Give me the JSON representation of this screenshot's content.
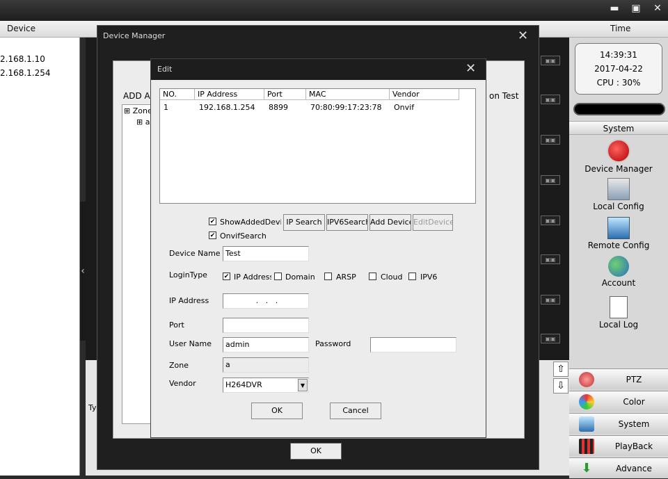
{
  "header": {
    "device_label": "Device",
    "time_label": "Time"
  },
  "left_list": {
    "items": [
      "2.168.1.10",
      "2.168.1.254"
    ]
  },
  "video_cell_icon": "camera-icon",
  "dm_partial": {
    "add": "ADD AR",
    "zone": "Zone",
    "zone_child": "a",
    "test": "on Test",
    "bottom_tab": "Ty"
  },
  "clock": {
    "time": "14:39:31",
    "date": "2017-04-22",
    "cpu": "CPU : 30%"
  },
  "system_header": "System",
  "tools": [
    {
      "label": "Device Manager",
      "icon": "device-manager-icon"
    },
    {
      "label": "Local Config",
      "icon": "local-config-icon"
    },
    {
      "label": "Remote Config",
      "icon": "remote-config-icon"
    },
    {
      "label": "Account",
      "icon": "account-icon"
    },
    {
      "label": "Local Log",
      "icon": "local-log-icon"
    }
  ],
  "menu": [
    {
      "label": "PTZ",
      "icon": "ptz-icon"
    },
    {
      "label": "Color",
      "icon": "color-icon"
    },
    {
      "label": "System",
      "icon": "system-icon"
    },
    {
      "label": "PlayBack",
      "icon": "playback-icon"
    },
    {
      "label": "Advance",
      "icon": "advance-icon"
    }
  ],
  "device_manager": {
    "title": "Device Manager",
    "ok": "OK"
  },
  "edit": {
    "title": "Edit",
    "columns": [
      "NO.",
      "IP Address",
      "Port",
      "MAC",
      "Vendor"
    ],
    "rows": [
      {
        "no": "1",
        "ip": "192.168.1.254",
        "port": "8899",
        "mac": "70:80:99:17:23:78",
        "vendor": "Onvif"
      }
    ],
    "show_added": "ShowAddedDevice",
    "onvif_search": "OnvifSearch",
    "buttons": {
      "ip_search": "IP Search",
      "ipv6_search": "IPV6Search",
      "add_device": "Add Device",
      "edit_device": "EditDevice"
    },
    "device_name_label": "Device Name",
    "device_name_value": "Test",
    "login_type_label": "LoginType",
    "login_types": [
      "IP Address",
      "Domain",
      "ARSP",
      "Cloud",
      "IPV6"
    ],
    "ip_label": "IP Address",
    "ip_value": ".   .   .",
    "port_label": "Port",
    "port_value": "",
    "user_label": "User Name",
    "user_value": "admin",
    "password_label": "Password",
    "password_value": "",
    "zone_label": "Zone",
    "zone_value": "a",
    "vendor_label": "Vendor",
    "vendor_value": "H264DVR",
    "ok": "OK",
    "cancel": "Cancel"
  }
}
